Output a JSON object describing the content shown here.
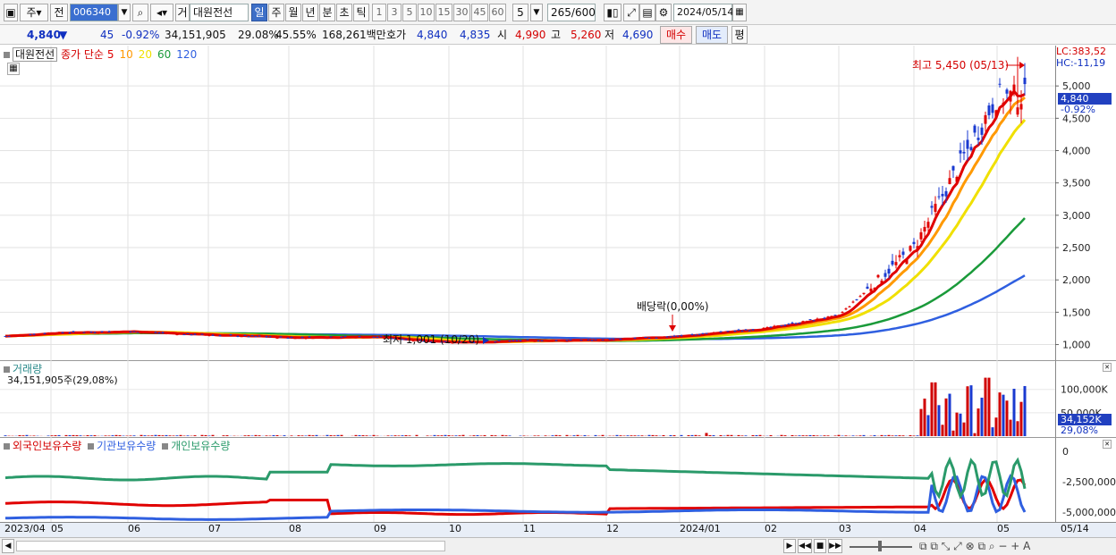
{
  "toolbar": {
    "type_label": "주",
    "prev_label": "전",
    "code": "006340",
    "exchange_label": "거",
    "name": "대원전선",
    "periods": [
      "일",
      "주",
      "월",
      "년",
      "분",
      "초",
      "틱"
    ],
    "active_period": "일",
    "intervals": [
      "1",
      "3",
      "5",
      "10",
      "15",
      "30",
      "45",
      "60"
    ],
    "interval_value": "5",
    "count": "265",
    "count_max": "/600",
    "date": "2024/05/14"
  },
  "quote": {
    "price": "4,840",
    "change_arrow": "▼",
    "change": "45",
    "change_pct": "-0.92%",
    "volume": "34,151,905",
    "volume_ratio": "29.08%",
    "turnover": "45.55%",
    "amount": "168,261백만",
    "hoga_label": "호가",
    "ask": "4,840",
    "bid": "4,835",
    "open_label": "시",
    "open": "4,990",
    "high_label": "고",
    "high": "5,260",
    "low_label": "저",
    "low": "4,690",
    "buy_label": "매수",
    "sell_label": "매도",
    "eval_label": "평"
  },
  "price_panel": {
    "name_label": "대원전선",
    "ma_label": "종가 단순",
    "ma_periods": [
      "5",
      "10",
      "20",
      "60",
      "120"
    ],
    "ma_colors": [
      "#e00000",
      "#ff9900",
      "#f0e000",
      "#1a9a3a",
      "#2f5fe0"
    ],
    "lc_label": "LC:383,52",
    "hc_label": "HC:-11,19",
    "high_annotation": "최고 5,450 (05/13)",
    "low_annotation": "최저 1,001 (10/20)",
    "dividend_annotation": "배당락(0,00%)",
    "price_tag": "4,840",
    "pct_tag": "-0.92%",
    "y_ticks": [
      "5,000",
      "4,500",
      "4,000",
      "3,500",
      "3,000",
      "2,500",
      "2,000",
      "1,500",
      "1,000"
    ]
  },
  "volume_panel": {
    "title": "거래량",
    "value_label": "34,151,905주(29,08%)",
    "y_ticks": [
      "100,000K",
      "50,000K"
    ],
    "value_tag": "34,152K",
    "pct_tag": "29,08%"
  },
  "holdings_panel": {
    "series_labels": [
      "외국인보유수량",
      "기관보유수량",
      "개인보유수량"
    ],
    "series_colors": [
      "#e00000",
      "#2f5fe0",
      "#2a9a6a"
    ],
    "y_ticks": [
      "0",
      "-2,500,000",
      "-5,000,000"
    ]
  },
  "x_axis": {
    "labels": [
      "2023/04",
      "05",
      "06",
      "07",
      "08",
      "09",
      "10",
      "11",
      "12",
      "2024/01",
      "02",
      "03",
      "04",
      "05"
    ],
    "end_label": "05/14"
  },
  "chart_data": {
    "type": "candlestick",
    "y_range": [
      800,
      5500
    ],
    "months": [
      "2023/04",
      "05",
      "06",
      "07",
      "08",
      "09",
      "10",
      "11",
      "12",
      "2024/01",
      "02",
      "03",
      "04",
      "05"
    ],
    "close_by_month": [
      1130,
      1180,
      1200,
      1150,
      1110,
      1120,
      1030,
      1060,
      1070,
      1130,
      1250,
      1450,
      2500,
      4840
    ],
    "period_high": 5450,
    "period_low": 1001,
    "last_close": 4840
  }
}
